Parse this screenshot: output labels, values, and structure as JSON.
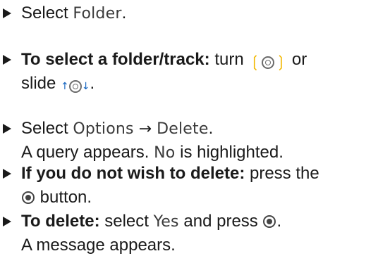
{
  "steps": [
    {
      "id": "select-folder",
      "lines": [
        [
          {
            "t": "Select "
          },
          {
            "t": "Folder",
            "d": true
          },
          {
            "t": "."
          }
        ]
      ]
    },
    {
      "id": "select-folder-track",
      "lines": [
        [
          {
            "t": "To select a folder/track:",
            "b": true
          },
          {
            "t": " turn "
          },
          {
            "icon": "turn-controller-icon"
          },
          {
            "t": " or"
          }
        ],
        [
          {
            "t": "slide "
          },
          {
            "icon": "slide-controller-icon"
          },
          {
            "t": "."
          }
        ]
      ]
    },
    {
      "id": "select-options-delete",
      "lines": [
        [
          {
            "t": "Select "
          },
          {
            "t": "Options",
            "d": true
          },
          {
            "t": "  →  ",
            "arrow": true
          },
          {
            "t": "Delete",
            "d": true
          },
          {
            "t": "."
          }
        ],
        [
          {
            "t": "A query appears. "
          },
          {
            "t": "No",
            "d": true
          },
          {
            "t": " is highlighted."
          }
        ]
      ]
    },
    {
      "id": "do-not-delete",
      "lines": [
        [
          {
            "t": "If you do not wish to delete:",
            "b": true
          },
          {
            "t": " press the"
          }
        ],
        [
          {
            "icon": "press-controller-icon"
          },
          {
            "t": " button."
          }
        ]
      ]
    },
    {
      "id": "to-delete",
      "lines": [
        [
          {
            "t": "To delete:",
            "b": true
          },
          {
            "t": " select "
          },
          {
            "t": "Yes",
            "d": true
          },
          {
            "t": " and press "
          },
          {
            "icon": "press-controller-icon"
          },
          {
            "t": "."
          }
        ],
        [
          {
            "t": "A message appears."
          }
        ]
      ]
    }
  ]
}
